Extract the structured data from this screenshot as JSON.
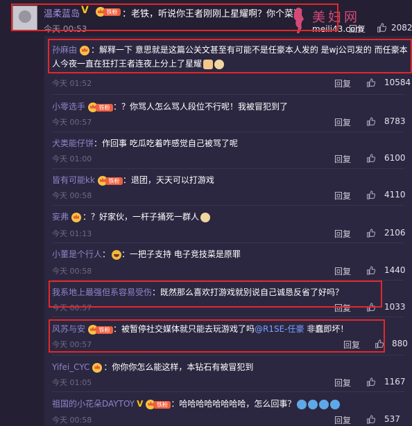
{
  "watermark": {
    "logo_text": "美妇网",
    "site": "meili43.com"
  },
  "top": {
    "name": "温柔蓝岛",
    "v_label": "V",
    "badge": "铁粉",
    "text": "：老铁，听说你王者刚刚上星耀啊？你个菜逼",
    "time": "今天 00:53",
    "reply_label": "回复",
    "likes": "2082"
  },
  "comments": [
    {
      "name": "孙麻由",
      "badge": "",
      "text": "：解释一下 意思就是这篇公关文甚至有可能不是任豪本人发的 是wj公司发的 而任豪本人今夜一直在狂打王者连夜上分上了星耀",
      "time": "今天 01:52",
      "reply_label": "回复",
      "likes": "10584"
    },
    {
      "name": "小零选手",
      "badge": "铁粉",
      "text": "：？你骂人怎么骂人段位不行呢！我被冒犯到了",
      "time": "今天 00:57",
      "reply_label": "回复",
      "likes": "8783"
    },
    {
      "name": "犬类能仔饼",
      "badge": "",
      "text": "：作回事 吃瓜吃着咋感觉自己被骂了呢",
      "time": "今天 01:00",
      "reply_label": "回复",
      "likes": "6100"
    },
    {
      "name": "皆有可能kk",
      "badge": "铁粉",
      "text": "：退团，天天可以打游戏",
      "time": "今天 00:58",
      "reply_label": "回复",
      "likes": "4110"
    },
    {
      "name": "妄弗",
      "badge": "",
      "text": "：？好家伙，一杆子捅死一群人",
      "time": "今天 01:13",
      "reply_label": "回复",
      "likes": "2106"
    },
    {
      "name": "小董是个行人",
      "badge": "",
      "text": "：一把子支持 电子竞技菜是原罪",
      "time": "今天 00:58",
      "reply_label": "回复",
      "likes": "1440"
    },
    {
      "name": "我系地上最强但系容易受伤",
      "badge": "",
      "text": "：既然那么喜欢打游戏就别说自己诚恳反省了好吗？",
      "time": "今天 00:57",
      "reply_label": "回复",
      "likes": "1033"
    },
    {
      "name": "风苏与安",
      "badge": "铁粉",
      "text": "：被暂停社交媒体就只能去玩游戏了吗",
      "mention": "@R1SE-任豪",
      "tail": " 非蠢即坏！",
      "time": "今天 00:57",
      "reply_label": "回复",
      "likes": "880"
    },
    {
      "name": "Yifei_CYC",
      "badge": "",
      "text": "：你你你怎么能这样，本钻石有被冒犯到",
      "time": "今天 01:05",
      "reply_label": "回复",
      "likes": "1167"
    },
    {
      "name": "祖国的小花朵DAYTOY",
      "v_label": "V",
      "badge": "铁粉",
      "text": "：哈哈哈哈哈哈哈哈，怎么回事？",
      "time": "今天 00:58",
      "reply_label": "回复",
      "likes": "537"
    }
  ]
}
